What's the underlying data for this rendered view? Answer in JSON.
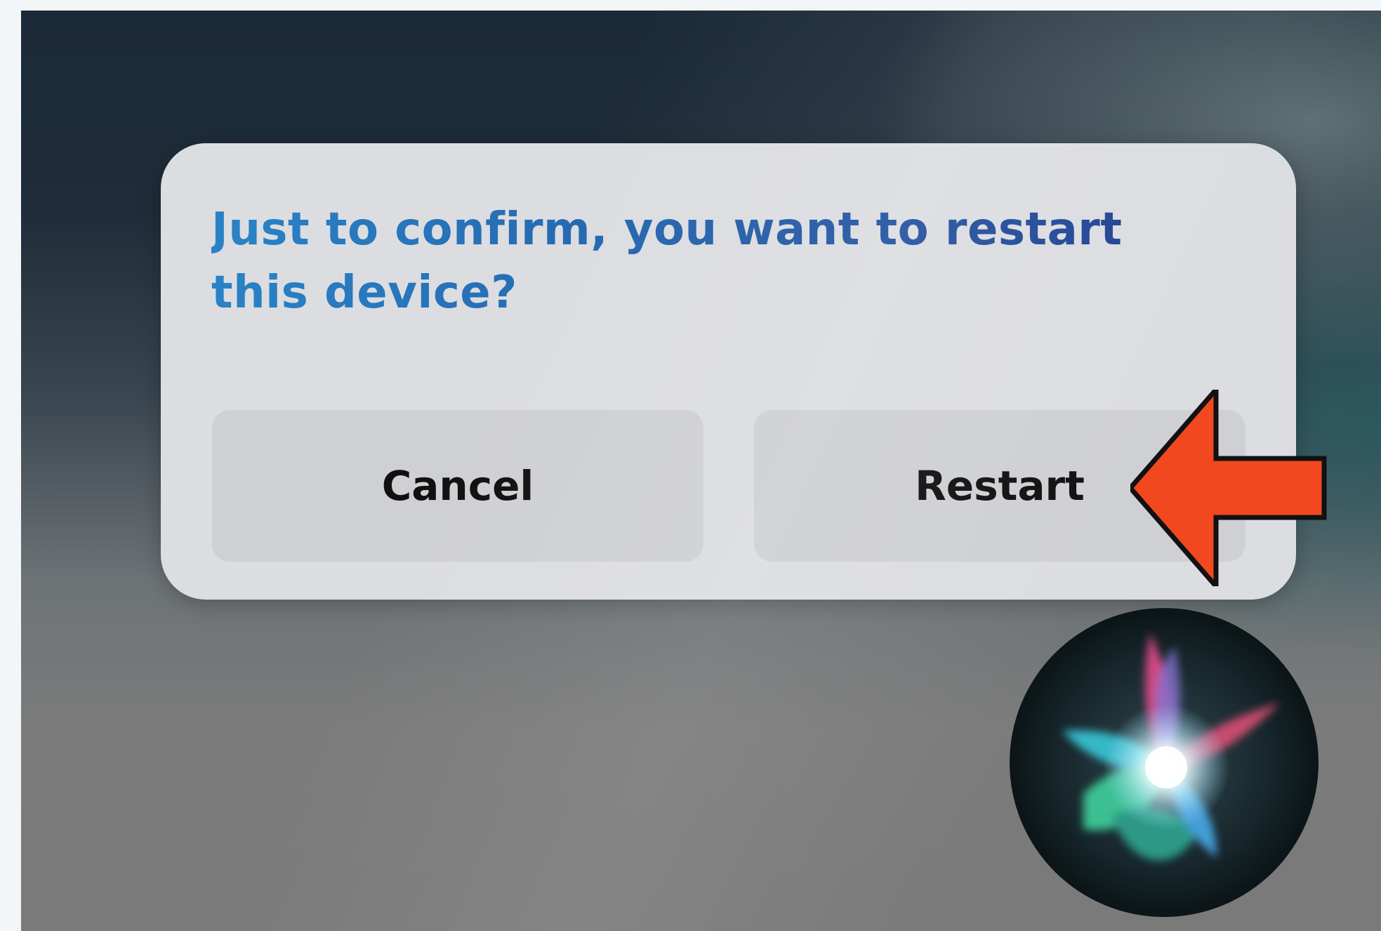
{
  "dialog": {
    "question": "Just to confirm, you want to restart this device?",
    "cancel_label": "Cancel",
    "restart_label": "Restart"
  },
  "icons": {
    "annotation_arrow": "arrow-left-icon",
    "assistant_orb": "siri-orb-icon"
  },
  "colors": {
    "question_text_start": "#2a83c6",
    "question_text_end": "#1f3d8e",
    "button_bg": "#cfd0d4",
    "dialog_bg": "#dcdde1",
    "annotation_arrow": "#f2481f"
  }
}
